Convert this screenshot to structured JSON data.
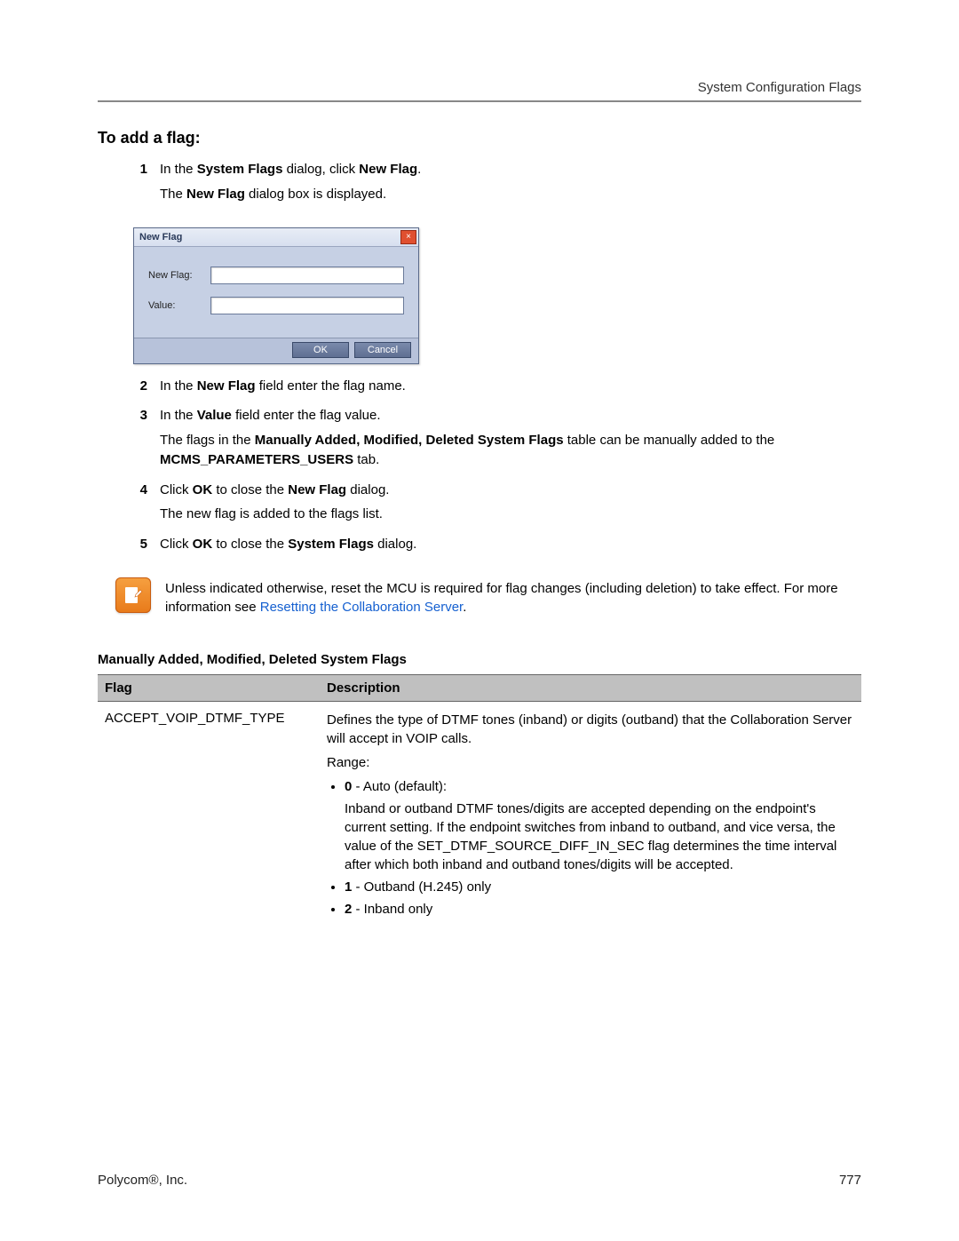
{
  "header": {
    "running_title": "System Configuration Flags"
  },
  "section_title": "To add a flag:",
  "steps": {
    "s1_num": "1",
    "s1_a": "In the ",
    "s1_b": "System Flags",
    "s1_c": " dialog, click ",
    "s1_d": "New Flag",
    "s1_e": ".",
    "s1_cont_a": "The ",
    "s1_cont_b": "New Flag",
    "s1_cont_c": " dialog box is displayed.",
    "s2_num": "2",
    "s2_a": "In the ",
    "s2_b": "New Flag",
    "s2_c": " field enter the flag name.",
    "s3_num": "3",
    "s3_a": "In the ",
    "s3_b": "Value",
    "s3_c": " field enter the flag value.",
    "s3_cont_a": "The flags in the ",
    "s3_cont_b": "Manually Added, Modified, Deleted System Flags",
    "s3_cont_c": " table can be manually added to the ",
    "s3_cont_d": "MCMS_PARAMETERS_USERS",
    "s3_cont_e": " tab.",
    "s4_num": "4",
    "s4_a": "Click ",
    "s4_b": "OK",
    "s4_c": " to close the ",
    "s4_d": "New Flag",
    "s4_e": " dialog.",
    "s4_cont": "The new flag is added to the flags list.",
    "s5_num": "5",
    "s5_a": "Click ",
    "s5_b": "OK",
    "s5_c": " to close the ",
    "s5_d": "System Flags",
    "s5_e": " dialog."
  },
  "dialog": {
    "title": "New Flag",
    "label_new_flag": "New Flag:",
    "label_value": "Value:",
    "input_new_flag": "",
    "input_value": "",
    "ok": "OK",
    "cancel": "Cancel",
    "close_glyph": "×"
  },
  "note": {
    "text_a": "Unless indicated otherwise, reset the MCU is required for flag changes (including deletion) to take effect. For more information see ",
    "link": "Resetting the Collaboration Server",
    "text_b": "."
  },
  "table": {
    "title": "Manually Added, Modified, Deleted System Flags",
    "head_flag": "Flag",
    "head_desc": "Description",
    "row1": {
      "flag": "ACCEPT_VOIP_DTMF_TYPE",
      "p1": "Defines the type of DTMF tones (inband) or digits (outband) that the Collaboration Server will accept in VOIP calls.",
      "p2": "Range:",
      "b0_num": "0",
      "b0_txt": " - Auto (default):",
      "b0_sub": "Inband or outband DTMF tones/digits are accepted depending on the endpoint's current setting. If the endpoint switches from inband to outband, and vice versa, the value of the SET_DTMF_SOURCE_DIFF_IN_SEC flag determines the time interval after which both inband and outband tones/digits will be accepted.",
      "b1_num": "1",
      "b1_txt": " - Outband (H.245) only",
      "b2_num": "2",
      "b2_txt": " - Inband only"
    }
  },
  "footer": {
    "left": "Polycom®, Inc.",
    "right": "777"
  }
}
